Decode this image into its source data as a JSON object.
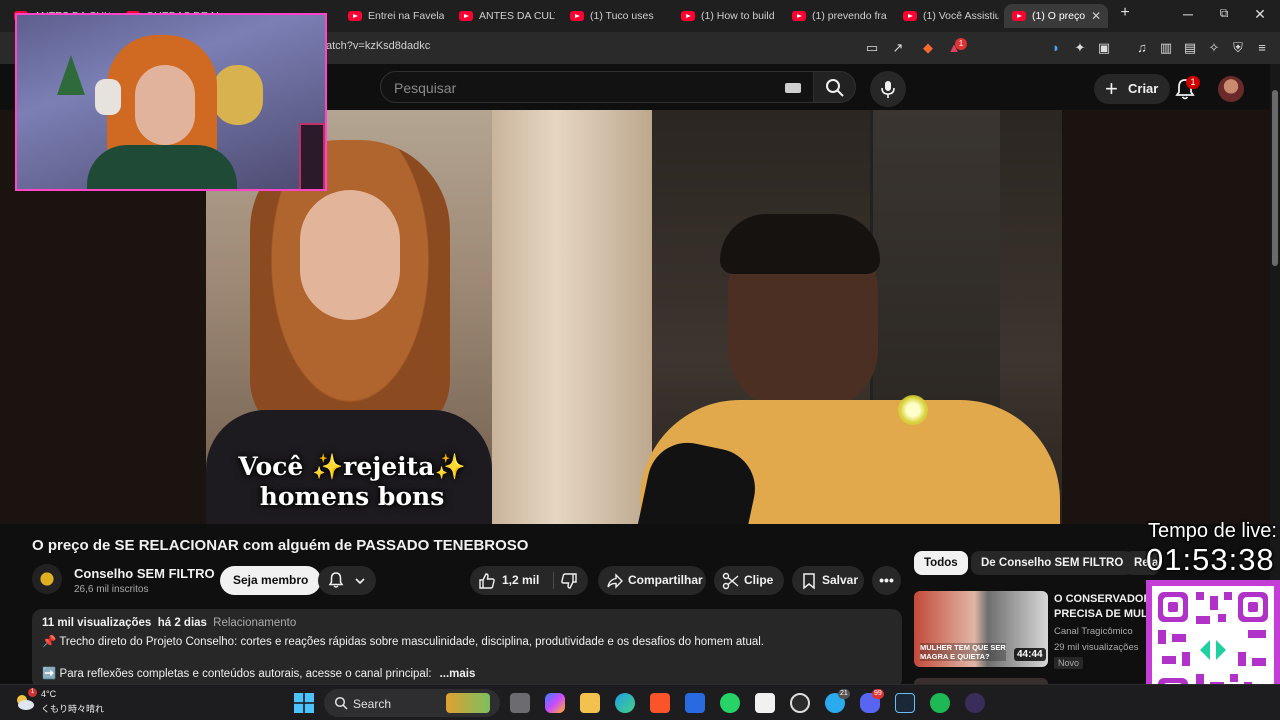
{
  "browser": {
    "tabs": [
      {
        "label": "ANTES DA CULTU"
      },
      {
        "label": "QUEDAS DE M"
      },
      {
        "label": "Entrei na Favela"
      },
      {
        "label": "ANTES DA CULT"
      },
      {
        "label": "(1) Tuco uses"
      },
      {
        "label": "(1) How to build"
      },
      {
        "label": "(1) prevendo fra"
      },
      {
        "label": "(1) Você Assistiu"
      },
      {
        "label": "(1) O preço"
      }
    ],
    "new_tab": "+",
    "close_tab": "✕",
    "window_controls": {
      "minimize": "─",
      "maximize": "⧉",
      "close": "✕"
    },
    "url": "atch?v=kzKsd8dadkc",
    "brave_badge": "1"
  },
  "youtube": {
    "search_placeholder": "Pesquisar",
    "create_label": "Criar",
    "notifications_count": "1",
    "video": {
      "caption_line1_pre": "Você ",
      "caption_spark": "✨",
      "caption_line1_word": "rejeita",
      "caption_line2": "homens bons"
    },
    "title": "O preço de SE RELACIONAR com alguém de PASSADO TENEBROSO",
    "channel": {
      "name": "Conselho SEM FILTRO",
      "subs": "26,6 mil inscritos"
    },
    "join_label": "Seja membro",
    "likes": "1,2 mil",
    "share_label": "Compartilhar",
    "clip_label": "Clipe",
    "save_label": "Salvar",
    "more_label": "•••",
    "description": {
      "views": "11 mil visualizações",
      "date": "há 2 dias",
      "tag": "Relacionamento",
      "line1_icon": "📌",
      "line1": "Trecho direto do Projeto Conselho: cortes e reações rápidas sobre masculinidade, disciplina, produtividade e os desafios do homem atual.",
      "line2_icon": "➡️",
      "line2": "Para reflexões completas e conteúdos autorais, acesse o canal principal:",
      "more": "...mais"
    },
    "chips": [
      {
        "label": "Todos"
      },
      {
        "label": "De Conselho SEM FILTRO"
      },
      {
        "label": "Relacion"
      }
    ],
    "recommendation": {
      "thumb_text_line1": "MULHER TEM QUE SER",
      "thumb_text_line2": "MAGRA E QUIETA?",
      "duration": "44:44",
      "title_line1": "O CONSERVADOR",
      "title_line2": "PRECISA DE MULH",
      "channel": "Canal Tragicômico",
      "views": "29 mil visualizações",
      "badge": "Novo"
    }
  },
  "overlay": {
    "timer_label": "Tempo de live:",
    "timer_value": "01:53:38"
  },
  "taskbar": {
    "weather_temp": "4°C",
    "weather_cond": "くもり時々晴れ",
    "weather_badge": "1",
    "search_label": "Search",
    "badge_telegram": "21",
    "badge_discord": "99"
  },
  "colors": {
    "accent": "#ff0033",
    "webcam_border": "#ff46c8",
    "qr_frame": "#c43dd7"
  }
}
